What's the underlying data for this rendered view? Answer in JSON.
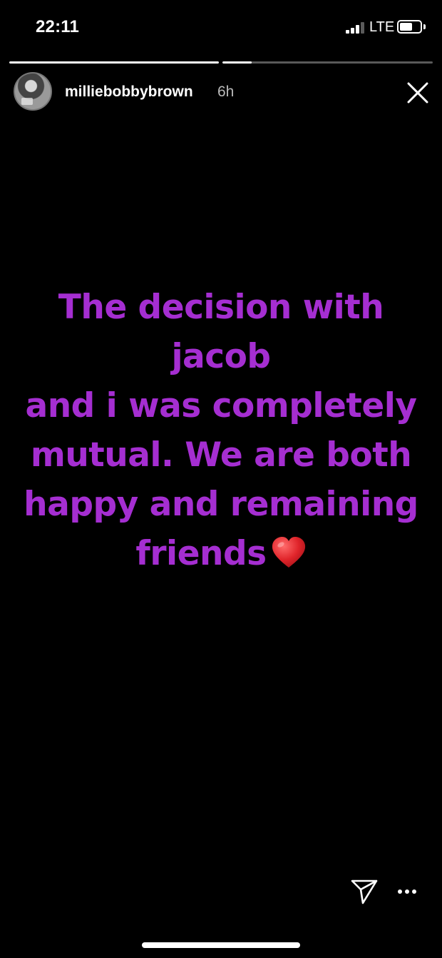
{
  "status_bar": {
    "time": "22:11",
    "network": "LTE",
    "battery_level": 0.62
  },
  "progress": {
    "segments": [
      {
        "progress": 1.0
      },
      {
        "progress": 0.14
      }
    ]
  },
  "header": {
    "username": "milliebobbybrown",
    "time_ago": "6h",
    "close_icon": "close-icon"
  },
  "story": {
    "text_color": "#a52ed1",
    "lines": [
      "The decision with jacob",
      "and i was completely",
      "mutual. We are both",
      "happy and remaining",
      "friends"
    ],
    "emoji": "heart-emoji"
  },
  "actions": {
    "send_icon": "paper-plane-icon",
    "more_icon": "more-horizontal-icon"
  }
}
